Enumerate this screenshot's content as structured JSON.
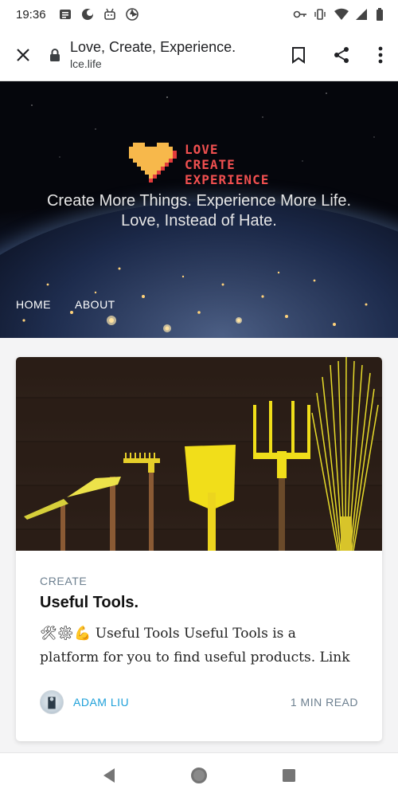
{
  "status_bar": {
    "time": "19:36"
  },
  "browser": {
    "title": "Love, Create, Experience.",
    "url": "lce.life"
  },
  "hero": {
    "logo_lines": [
      "LOVE",
      "CREATE",
      "EXPERIENCE"
    ],
    "tagline_line1": "Create More Things. Experience More Life.",
    "tagline_line2": "Love, Instead of Hate.",
    "nav": [
      "HOME",
      "ABOUT"
    ]
  },
  "post": {
    "tag": "CREATE",
    "title": "Useful Tools.",
    "excerpt_emoji": "🛠⚙💪",
    "excerpt": "Useful Tools Useful Tools is a platform for you to find useful products. Link",
    "author": "ADAM LIU",
    "read_time": "1 MIN READ"
  },
  "colors": {
    "logo_red": "#ef4f4f",
    "heart_yellow": "#f7b84b",
    "author_blue": "#1ea0d9",
    "tag_gray": "#6c7f8f"
  }
}
